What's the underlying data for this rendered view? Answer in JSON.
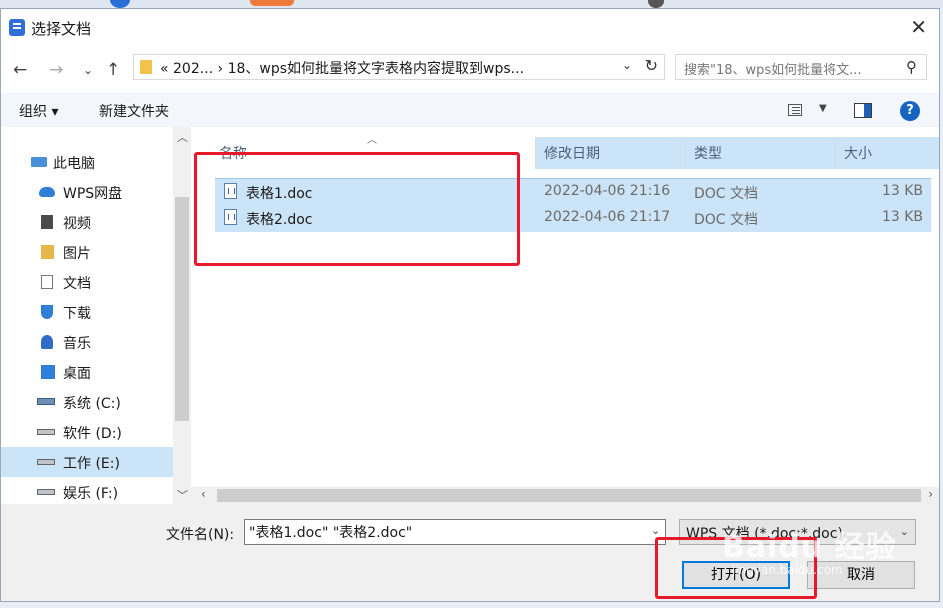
{
  "window": {
    "title": "选择文档"
  },
  "address": {
    "breadcrumb": "«  202...  ›  18、wps如何批量将文字表格内容提取到wps...",
    "search_placeholder": "搜索\"18、wps如何批量将文..."
  },
  "toolbar": {
    "organize": "组织 ▾",
    "new_folder": "新建文件夹"
  },
  "nav": {
    "items": [
      {
        "label": "此电脑",
        "icon": "computer-icon"
      },
      {
        "label": "WPS网盘",
        "icon": "cloud-icon"
      },
      {
        "label": "视频",
        "icon": "video-folder-icon"
      },
      {
        "label": "图片",
        "icon": "pictures-folder-icon"
      },
      {
        "label": "文档",
        "icon": "documents-folder-icon"
      },
      {
        "label": "下载",
        "icon": "downloads-folder-icon"
      },
      {
        "label": "音乐",
        "icon": "music-folder-icon"
      },
      {
        "label": "桌面",
        "icon": "desktop-folder-icon"
      },
      {
        "label": "系统 (C:)",
        "icon": "system-drive-icon"
      },
      {
        "label": "软件 (D:)",
        "icon": "drive-icon"
      },
      {
        "label": "工作 (E:)",
        "icon": "drive-icon"
      },
      {
        "label": "娱乐 (F:)",
        "icon": "drive-icon"
      }
    ],
    "selected": "工作 (E:)"
  },
  "files": {
    "columns": {
      "name": "名称",
      "modified": "修改日期",
      "type": "类型",
      "size": "大小"
    },
    "rows": [
      {
        "name": "表格1.doc",
        "modified": "2022-04-06 21:16",
        "type": "DOC 文档",
        "size": "13 KB"
      },
      {
        "name": "表格2.doc",
        "modified": "2022-04-06 21:17",
        "type": "DOC 文档",
        "size": "13 KB"
      }
    ]
  },
  "bottom": {
    "filename_label": "文件名(N):",
    "filename_value": "\"表格1.doc\" \"表格2.doc\"",
    "filter": "WPS 文档 (*.doc;*.doc)",
    "open": "打开(O)",
    "cancel": "取消"
  },
  "watermark": {
    "text": "Baidu 经验",
    "url": "jingyan.baidu.com"
  },
  "colors": {
    "highlight": "#e8192c",
    "selection": "#cce4f7",
    "accent": "#0078d7"
  }
}
